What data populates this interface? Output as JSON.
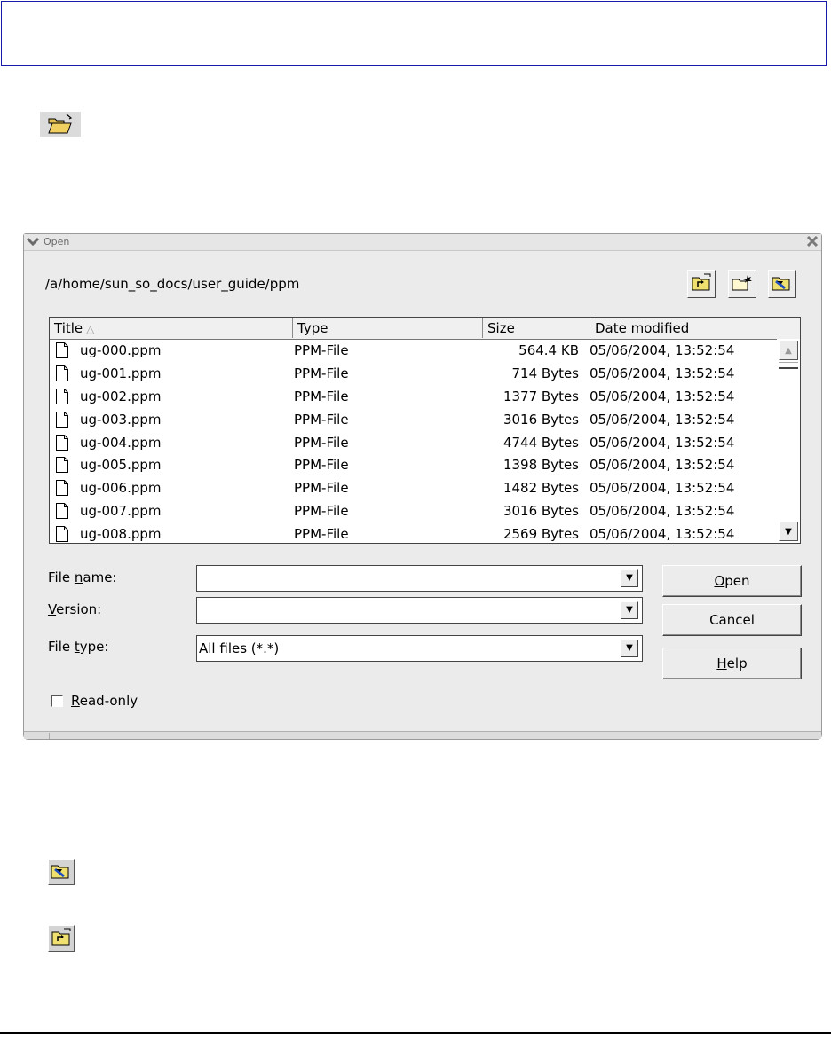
{
  "dialog": {
    "title": "Open",
    "path": "/a/home/sun_so_docs/user_guide/ppm",
    "toolbar": {
      "up_icon": "up-one-level-icon",
      "new_folder_icon": "new-folder-icon",
      "default_dir_icon": "default-directory-icon"
    },
    "columns": [
      "Title",
      "Type",
      "Size",
      "Date modified"
    ],
    "files": [
      {
        "name": "ug-000.ppm",
        "type": "PPM-File",
        "size": "564.4 KB",
        "date": "05/06/2004, 13:52:54"
      },
      {
        "name": "ug-001.ppm",
        "type": "PPM-File",
        "size": "714 Bytes",
        "date": "05/06/2004, 13:52:54"
      },
      {
        "name": "ug-002.ppm",
        "type": "PPM-File",
        "size": "1377 Bytes",
        "date": "05/06/2004, 13:52:54"
      },
      {
        "name": "ug-003.ppm",
        "type": "PPM-File",
        "size": "3016 Bytes",
        "date": "05/06/2004, 13:52:54"
      },
      {
        "name": "ug-004.ppm",
        "type": "PPM-File",
        "size": "4744 Bytes",
        "date": "05/06/2004, 13:52:54"
      },
      {
        "name": "ug-005.ppm",
        "type": "PPM-File",
        "size": "1398 Bytes",
        "date": "05/06/2004, 13:52:54"
      },
      {
        "name": "ug-006.ppm",
        "type": "PPM-File",
        "size": "1482 Bytes",
        "date": "05/06/2004, 13:52:54"
      },
      {
        "name": "ug-007.ppm",
        "type": "PPM-File",
        "size": "3016 Bytes",
        "date": "05/06/2004, 13:52:54"
      },
      {
        "name": "ug-008.ppm",
        "type": "PPM-File",
        "size": "2569 Bytes",
        "date": "05/06/2004, 13:52:54"
      }
    ],
    "file_name_label_pre": "File ",
    "file_name_label_u": "n",
    "file_name_label_post": "ame:",
    "file_name_value": "",
    "version_label_u": "V",
    "version_label_post": "ersion:",
    "version_value": "",
    "file_type_label_pre": "File ",
    "file_type_label_u": "t",
    "file_type_label_post": "ype:",
    "file_type_value": "All files (*.*)",
    "open_u": "O",
    "open_post": "pen",
    "cancel_label": "Cancel",
    "help_u": "H",
    "help_post": "elp",
    "readonly_u": "R",
    "readonly_post": "ead-only",
    "readonly_checked": false
  },
  "page_icons": [
    "open-folder-icon",
    "default-directory-icon",
    "up-one-level-icon"
  ]
}
